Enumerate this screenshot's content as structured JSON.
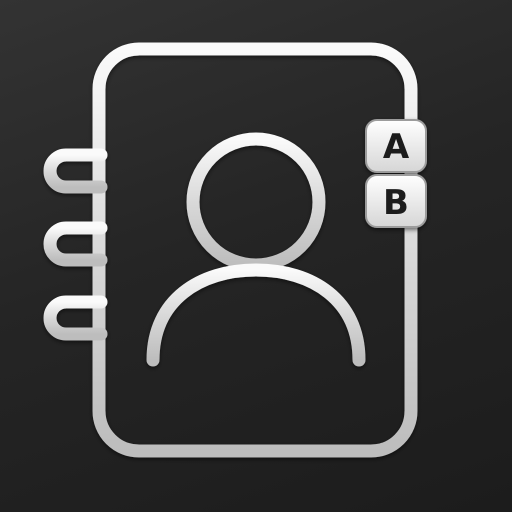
{
  "icon": {
    "name": "address-book-app-icon",
    "tabs": [
      {
        "letter": "A"
      },
      {
        "letter": "B"
      }
    ]
  },
  "colors": {
    "background": "#2a2a2a",
    "outline": "#e8e8e8",
    "tab_fill": "#f2f2f2",
    "tab_text": "#1e1e1e"
  }
}
